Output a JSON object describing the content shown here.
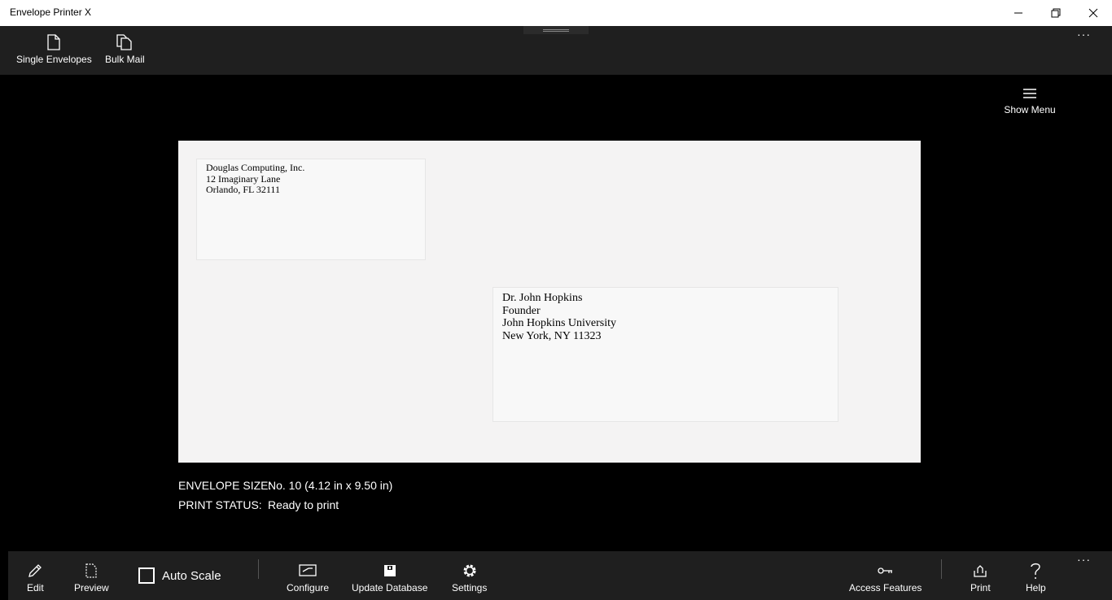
{
  "window": {
    "title": "Envelope Printer X"
  },
  "toolbar_top": {
    "single_envelopes": "Single Envelopes",
    "bulk_mail": "Bulk Mail",
    "more": "···"
  },
  "show_menu": "Show Menu",
  "envelope": {
    "return_address": [
      "Douglas Computing, Inc.",
      "12 Imaginary Lane",
      "Orlando, FL 32111"
    ],
    "recipient_address": [
      "Dr. John Hopkins",
      "Founder",
      "John Hopkins University",
      "New York, NY 11323"
    ]
  },
  "info": {
    "size_label": "ENVELOPE SIZE:",
    "size_value": "No. 10  (4.12 in x 9.50 in)",
    "status_label": "PRINT STATUS:",
    "status_value": "Ready to print"
  },
  "toolbar_bottom": {
    "edit": "Edit",
    "preview": "Preview",
    "auto_scale": "Auto Scale",
    "configure": "Configure",
    "update_database": "Update Database",
    "settings": "Settings",
    "access_features": "Access Features",
    "print": "Print",
    "help": "Help",
    "more": "···"
  },
  "colors": {
    "titlebar": "#ffffff",
    "toolbar": "#1f1f1f",
    "background": "#000000",
    "envelope": "#f4f3f3"
  }
}
